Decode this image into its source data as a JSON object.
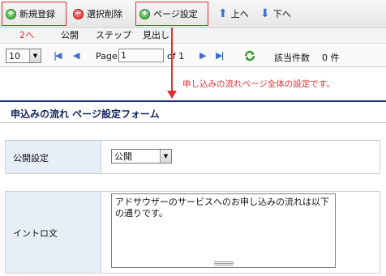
{
  "toolbar": {
    "new_label": "新規登録",
    "delete_label": "選択削除",
    "page_settings_label": "ページ設定",
    "up_label": "上へ",
    "down_label": "下へ"
  },
  "tabs": {
    "step_annotation": "2へ",
    "items": [
      "公開",
      "ステップ",
      "見出し"
    ]
  },
  "pager": {
    "per_page": "10",
    "page_label": "Page",
    "page_value": "1",
    "of_label": "of 1",
    "count_label": "該当件数",
    "count_value": "0 件"
  },
  "annotation": {
    "text": "申し込みの流れページ全体の設定です。"
  },
  "form": {
    "title": "申込みの流れ ページ設定フォーム",
    "publish": {
      "label": "公開設定",
      "value": "公開"
    },
    "intro": {
      "label": "イントロ文",
      "value": "アドサウザーのサービスへのお申し込みの流れは以下の通りです。"
    }
  },
  "colors": {
    "highlight": "#e03030",
    "title_border": "#1b2a8a",
    "label_bg": "#e8eef8",
    "accent_icon": "#3a6fd0"
  }
}
